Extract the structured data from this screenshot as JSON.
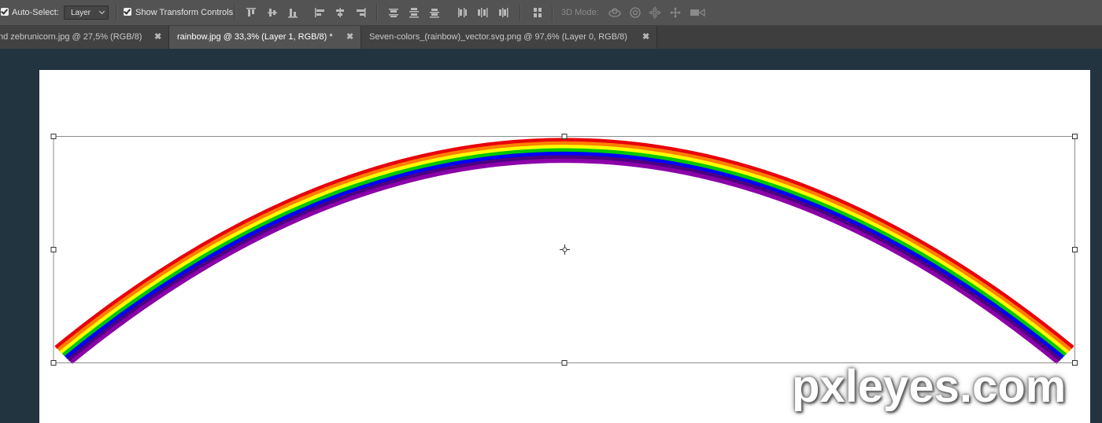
{
  "options_bar": {
    "auto_select_label": "Auto-Select:",
    "auto_select_checked": true,
    "auto_select_target": "Layer",
    "show_transform_label": "Show Transform Controls",
    "show_transform_checked": true,
    "mode_3d_label": "3D Mode:"
  },
  "tabs": [
    {
      "label": "nd zebrunicorn.jpg @ 27,5% (RGB/8)",
      "close": "✖",
      "active": false
    },
    {
      "label": "rainbow.jpg @ 33,3% (Layer 1, RGB/8) *",
      "close": "✖",
      "active": true
    },
    {
      "label": "Seven-colors_(rainbow)_vector.svg.png @ 97,6% (Layer 0, RGB/8)",
      "close": "✖",
      "active": false
    }
  ],
  "rainbow_colors": [
    "#e8000b",
    "#ff7f00",
    "#ffff00",
    "#00c800",
    "#0000ff",
    "#4b0082",
    "#8b00a8"
  ],
  "watermark": "pxleyes.com"
}
